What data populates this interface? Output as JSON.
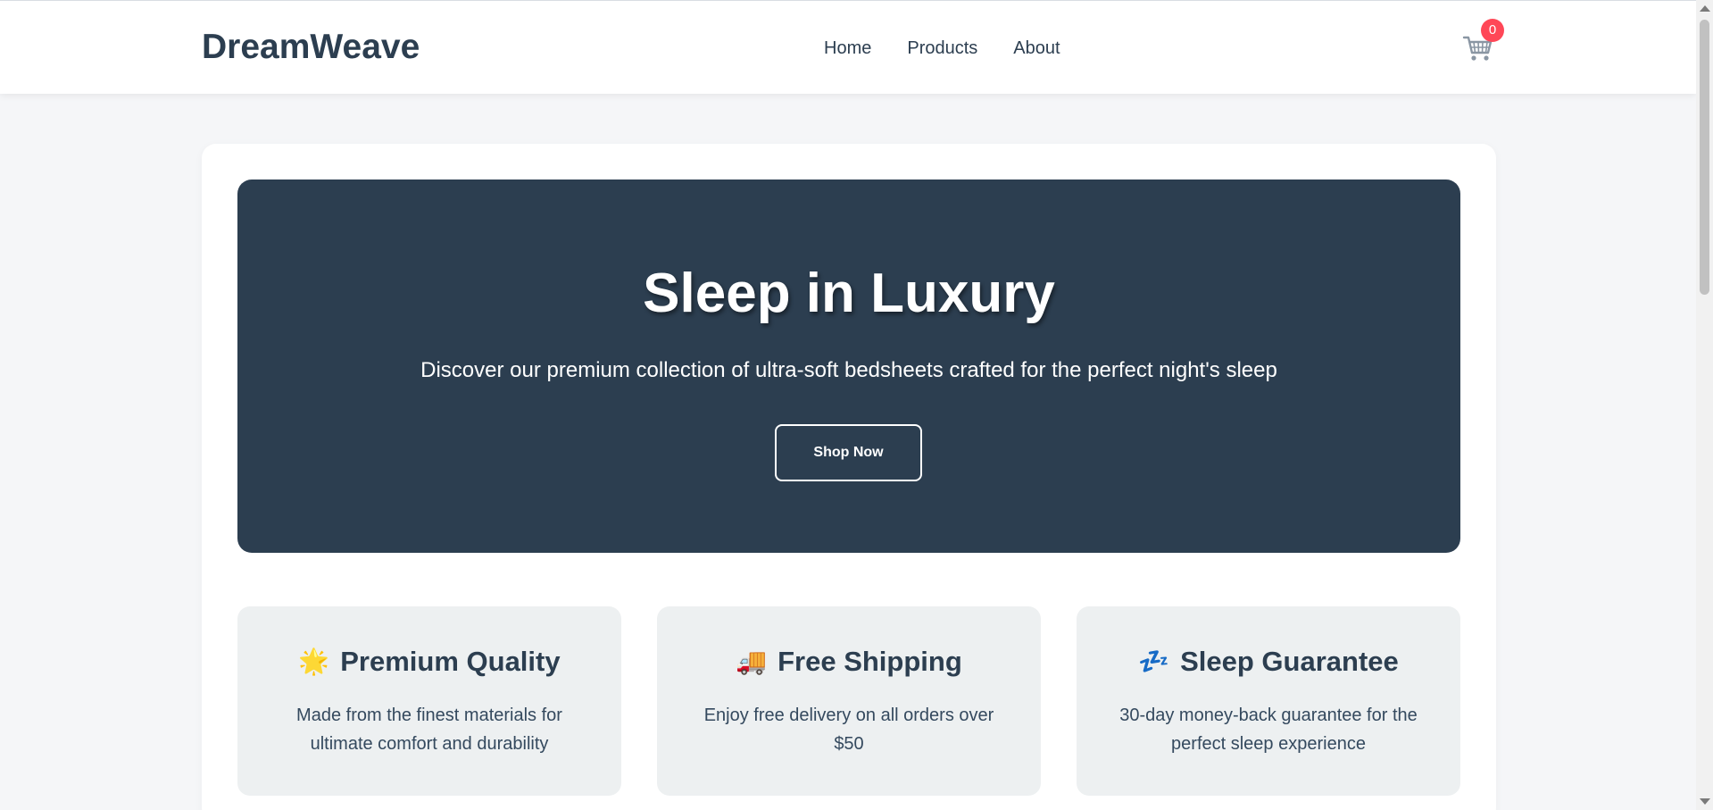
{
  "brand": {
    "name": "DreamWeave"
  },
  "nav": {
    "items": [
      "Home",
      "Products",
      "About"
    ]
  },
  "cart": {
    "count": "0",
    "icon": "shopping-cart-icon"
  },
  "hero": {
    "title": "Sleep in Luxury",
    "subtitle": "Discover our premium collection of ultra-soft bedsheets crafted for the perfect night's sleep",
    "cta_label": "Shop Now"
  },
  "features": [
    {
      "icon": "🌟",
      "icon_name": "star-icon",
      "title": "Premium Quality",
      "description": "Made from the finest materials for ultimate comfort and durability"
    },
    {
      "icon": "🚚",
      "icon_name": "truck-icon",
      "title": "Free Shipping",
      "description": "Enjoy free delivery on all orders over $50"
    },
    {
      "icon": "💤",
      "icon_name": "zzz-icon",
      "title": "Sleep Guarantee",
      "description": "30-day money-back guarantee for the perfect sleep experience"
    }
  ],
  "colors": {
    "primary": "#2c3e50",
    "badge": "#ff4757",
    "background": "#f5f6f8",
    "feature_bg": "#edf0f1"
  }
}
